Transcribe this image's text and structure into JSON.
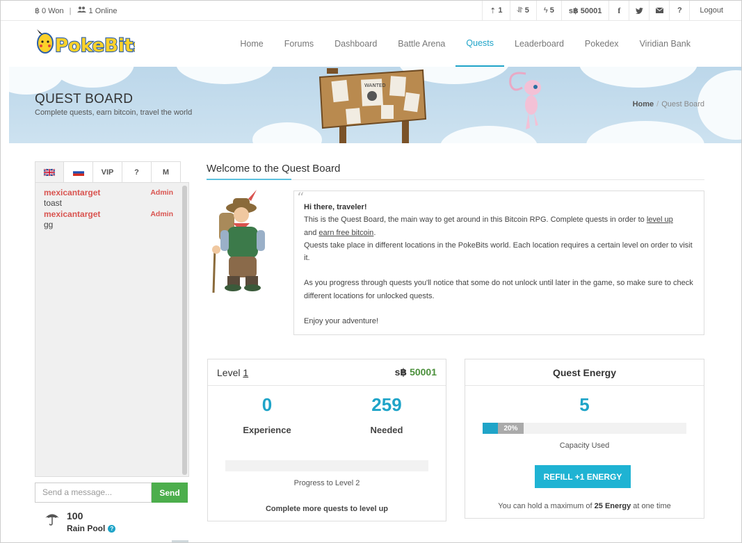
{
  "topbar": {
    "won": "฿ 0 Won",
    "online": "1 Online",
    "stat1": "1",
    "stat2": "5",
    "stat3": "5",
    "balance": "s฿ 50001",
    "logout": "Logout",
    "help": "?"
  },
  "nav": {
    "items": [
      "Home",
      "Forums",
      "Dashboard",
      "Battle Arena",
      "Quests",
      "Leaderboard",
      "Pokedex",
      "Viridian Bank"
    ],
    "active": "Quests"
  },
  "banner": {
    "title": "QUEST BOARD",
    "subtitle": "Complete quests, earn bitcoin, travel the world",
    "crumb_home": "Home",
    "crumb_sep": "/",
    "crumb_current": "Quest Board"
  },
  "chat": {
    "tabs": [
      "",
      "",
      "VIP",
      "?",
      "M"
    ],
    "messages": [
      {
        "user": "mexicantarget",
        "role": "Admin",
        "text": "toast"
      },
      {
        "user": "mexicantarget",
        "role": "Admin",
        "text": "gg"
      }
    ],
    "input_placeholder": "Send a message...",
    "send_label": "Send"
  },
  "rain_pool": {
    "amount": "100",
    "label": "Rain Pool",
    "help": "?"
  },
  "welcome": {
    "title": "Welcome to the Quest Board",
    "greeting": "Hi there, traveler!",
    "p1_a": "This is the Quest Board, the main way to get around in this Bitcoin RPG. Complete quests in order to ",
    "p1_link1": "level up",
    "p1_b": "and ",
    "p1_link2": "earn free bitcoin",
    "p1_c": ".",
    "p2": "Quests take place in different locations in the PokeBits world. Each location requires a certain level on order to visit it.",
    "p3": "As you progress through quests you'll notice that some do not unlock until later in the game, so make sure to check different locations for unlocked quests.",
    "p4": "Enjoy your adventure!"
  },
  "level": {
    "label": "Level ",
    "value": "1",
    "balance_prefix": "s฿ ",
    "balance": "50001",
    "experience": "0",
    "experience_label": "Experience",
    "needed": "259",
    "needed_label": "Needed",
    "progress_fraction": 0,
    "progress_label": "Progress to Level 2",
    "hint": "Complete more quests to level up"
  },
  "energy": {
    "title": "Quest Energy",
    "value": "5",
    "fraction": 0.2,
    "percent_label": "20%",
    "capacity_label": "Capacity Used",
    "refill_label": "REFILL +1 ENERGY",
    "max_a": "You can hold a maximum of ",
    "max_b": "25 Energy",
    "max_c": " at one time"
  },
  "colors": {
    "accent": "#1fa4c8",
    "admin": "#d9534f",
    "send": "#4cae4c",
    "balance_green": "#4a8f3a"
  }
}
